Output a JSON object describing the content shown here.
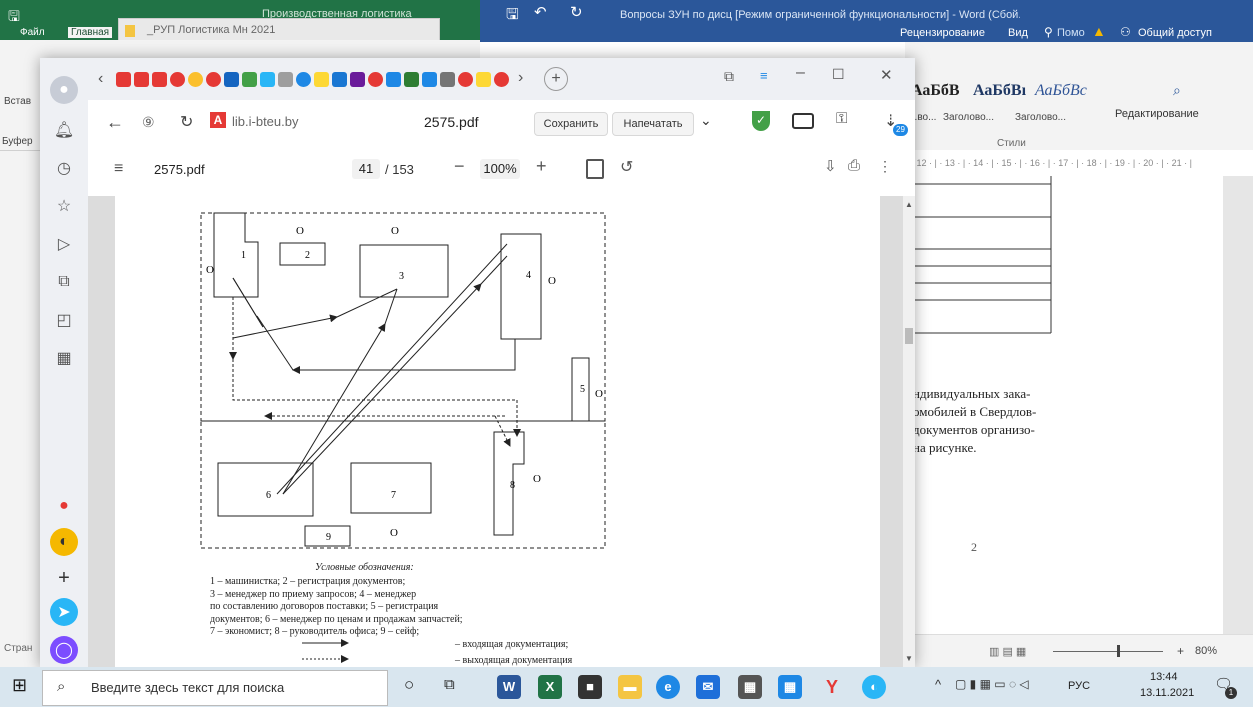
{
  "excel": {
    "title": "Производственная логистика",
    "menu_file": "Файл",
    "menu_home": "Главная",
    "paste": "Встав",
    "clipboard": "Буфер",
    "status": "Стран",
    "second_doc": "_РУП Логистика Мн 2021"
  },
  "word": {
    "title": "Вопросы ЗУН по дисц [Режим ограниченной функциональности] - Word (Сбой...",
    "menu_review": "Рецензирование",
    "menu_view": "Вид",
    "menu_help": "Помо",
    "share": "Общий доступ",
    "style_1": "АаБбВ",
    "style_2": "АаБбВı",
    "style_3": "АаБбВс",
    "style_label_1": "...во...",
    "style_label_2": "Заголово...",
    "style_label_3": "Заголово...",
    "styles_group": "Стили",
    "editing": "Редактирование",
    "ruler": "· 12 · | · 13 · | · 14 · | · 15 · | · 16 · | · 17 · | · 18 · | · 19 · | · 20 · | · 21 · |",
    "text_lines": [
      "ндивидуальных зака-",
      "омобилей в Свердлов-",
      "документов организо-",
      "на рисунке."
    ],
    "page_num": "2",
    "zoom": "80%"
  },
  "browser": {
    "domain": "lib.i-bteu.by",
    "page_title": "2575.pdf",
    "save_label": "Сохранить",
    "print_label": "Напечатать",
    "download_badge": "29"
  },
  "pdf": {
    "file": "2575.pdf",
    "page_current": "41",
    "page_total": "/ 153",
    "zoom": "100%",
    "legend_title": "Условные обозначения:",
    "legend_lines": [
      "1 – машинистка; 2 – регистрация документов;",
      "3 – менеджер по приему запросов; 4 – менеджер",
      "по составлению договоров поставки; 5 – регистрация",
      "документов; 6 – менеджер по ценам и продажам запчастей;",
      "7 – экономист; 8 – руководитель офиса; 9 – сейф;"
    ],
    "legend_in": "– входящая документация;",
    "legend_out": "– выходящая документация",
    "labels": {
      "n1": "1",
      "n2": "2",
      "n3": "3",
      "n4": "4",
      "n5": "5",
      "n6": "6",
      "n7": "7",
      "n8": "8",
      "n9": "9",
      "o": "О"
    }
  },
  "taskbar": {
    "search_placeholder": "Введите здесь текст для поиска",
    "lang": "РУС",
    "time": "13:44",
    "date": "13.11.2021",
    "notif_count": "1"
  }
}
